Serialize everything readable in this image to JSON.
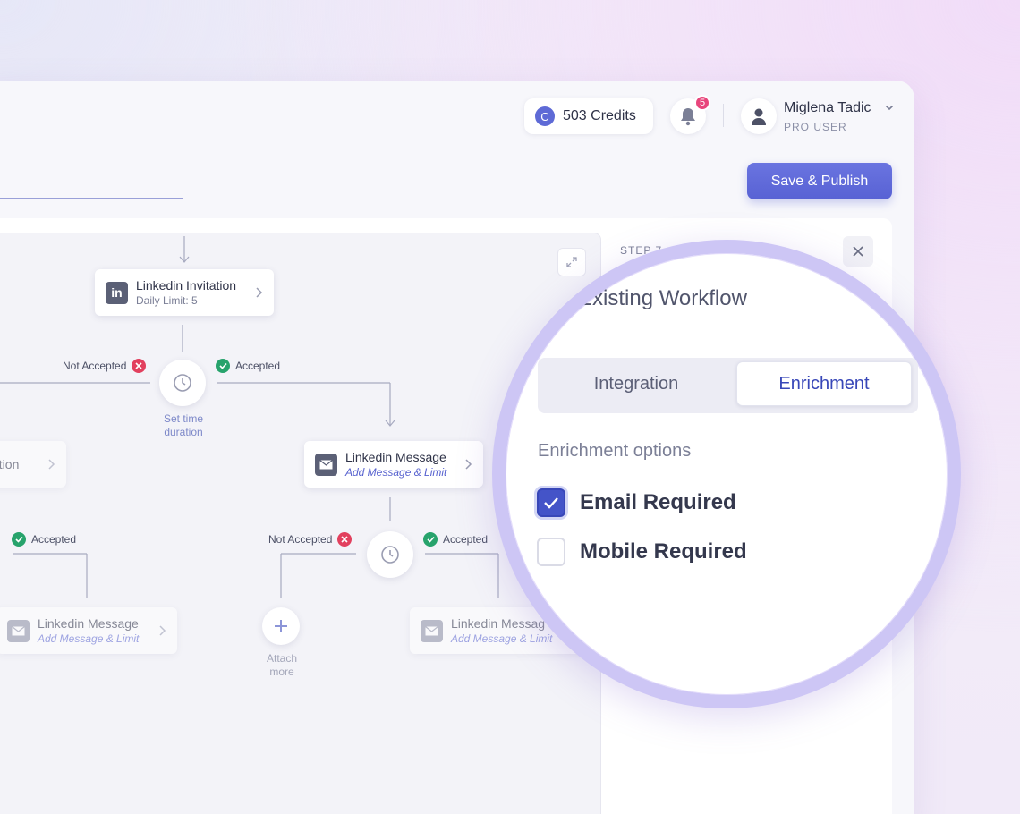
{
  "header": {
    "credits": "503 Credits",
    "credit_coin": "C",
    "notifications_count": "5",
    "user_name": "Miglena Tadic",
    "user_role": "PRO USER",
    "save_label": "Save & Publish"
  },
  "panel": {
    "step_label": "STEP 7",
    "title_partial": "Existing Workflow",
    "tabs": [
      {
        "label": "Integration",
        "active": false
      },
      {
        "label": "Enrichment",
        "active": true
      }
    ],
    "options_heading": "Enrichment options",
    "options": [
      {
        "label": "Email Required",
        "checked": true
      },
      {
        "label": "Mobile Required",
        "checked": false
      }
    ]
  },
  "flow": {
    "invitation": {
      "title": "Linkedin Invitation",
      "sub": "Daily Limit: 5"
    },
    "left_partial_node": {
      "title": "ation"
    },
    "message_main": {
      "title": "Linkedin Message",
      "sub": "Add Message & Limit"
    },
    "message_left": {
      "title": "Linkedin Message",
      "sub": "Add Message & Limit"
    },
    "message_right": {
      "title": "Linkedin Messag",
      "sub": "Add Message & Limit"
    },
    "not_accepted": "Not Accepted",
    "accepted": "Accepted",
    "set_time": "Set time\nduration",
    "attach_more": "Attach\nmore"
  },
  "colors": {
    "accent": "#5862d4",
    "accepted": "#27a36c",
    "not_accepted": "#e2405e",
    "badge": "#e8467c"
  }
}
